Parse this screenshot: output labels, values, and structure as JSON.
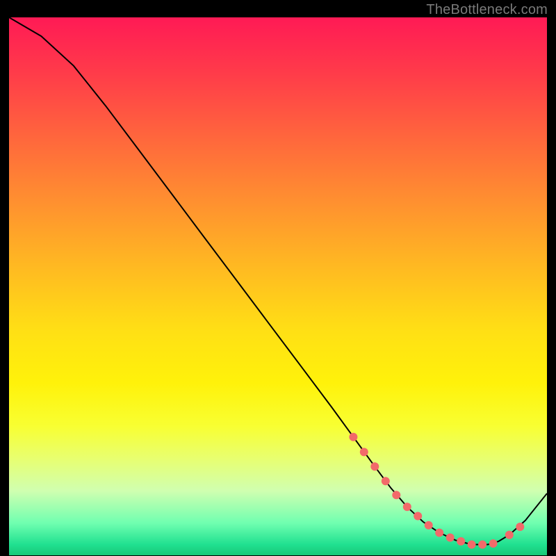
{
  "attribution": "TheBottleneck.com",
  "colors": {
    "dot": "#f26a6a",
    "curve": "#000000"
  },
  "chart_data": {
    "type": "line",
    "title": "",
    "xlabel": "",
    "ylabel": "",
    "xlim": [
      0,
      100
    ],
    "ylim": [
      0,
      100
    ],
    "x": [
      0,
      6,
      12,
      18,
      24,
      30,
      36,
      42,
      48,
      54,
      60,
      64,
      68,
      71,
      74,
      77,
      80,
      83,
      86,
      89,
      91,
      93,
      96,
      100
    ],
    "values": [
      100,
      96.5,
      91,
      83.5,
      75.5,
      67.5,
      59.5,
      51.5,
      43.5,
      35.5,
      27.5,
      22,
      16.5,
      12.5,
      9.0,
      6.2,
      4.2,
      2.8,
      2.0,
      2.0,
      2.6,
      3.8,
      6.5,
      11.5
    ],
    "marker_points_x": [
      64,
      66,
      68,
      70,
      72,
      74,
      76,
      78,
      80,
      82,
      84,
      86,
      88,
      90,
      93,
      95
    ],
    "marker_points_y": [
      22,
      19.2,
      16.5,
      13.8,
      11.2,
      9.0,
      7.3,
      5.6,
      4.2,
      3.3,
      2.6,
      2.0,
      2.0,
      2.2,
      3.8,
      5.3
    ]
  }
}
